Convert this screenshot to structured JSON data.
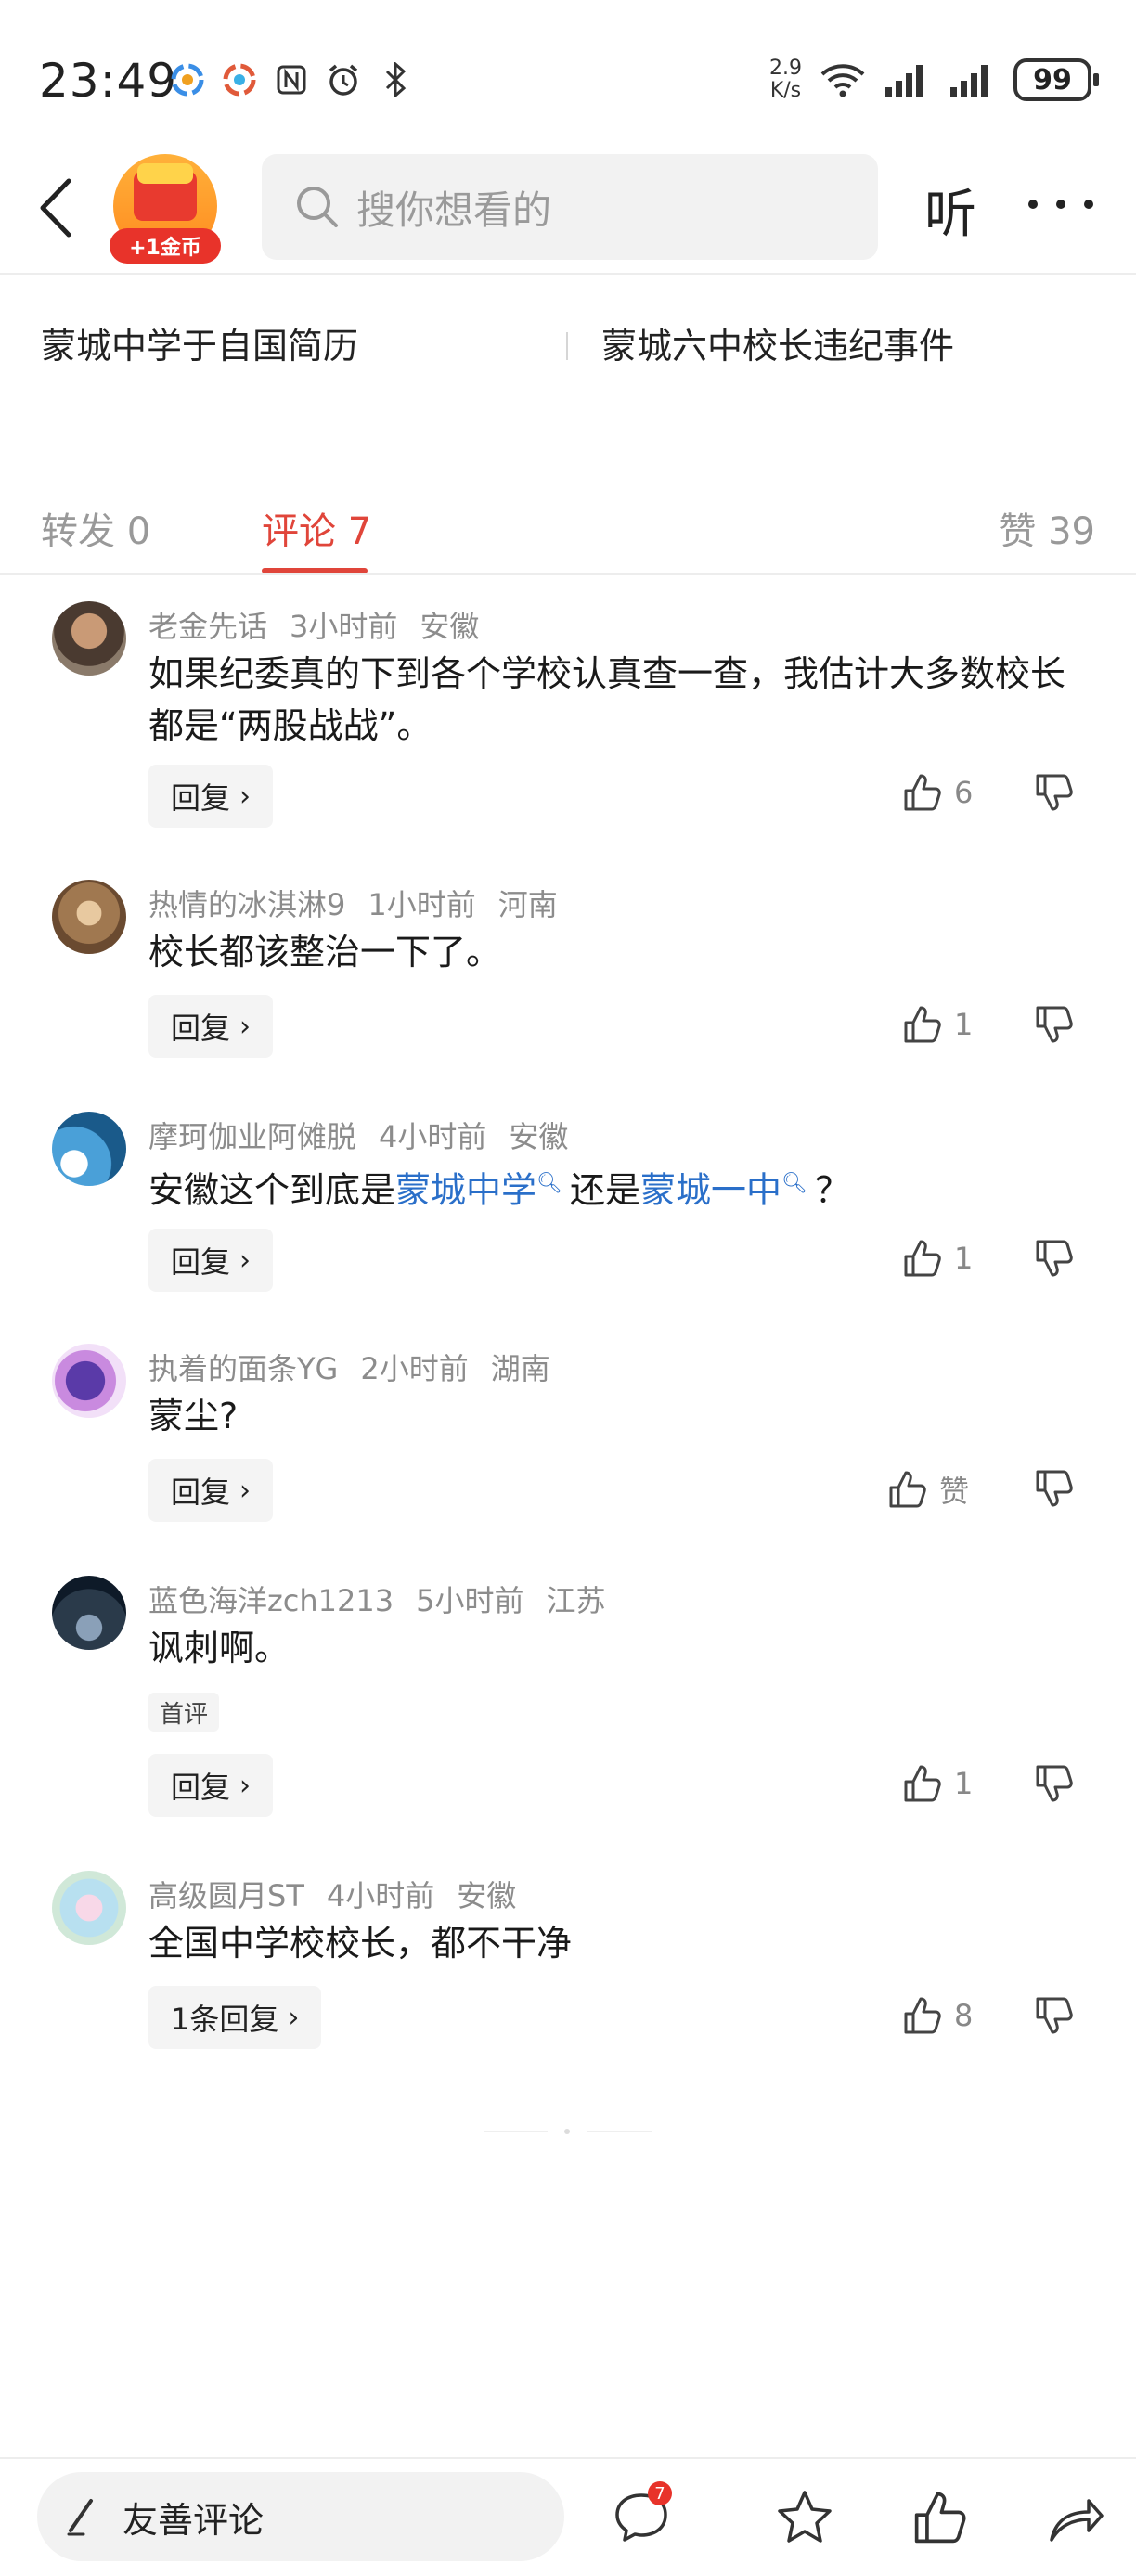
{
  "status_bar": {
    "time": "23:49",
    "net_speed_value": "2.9",
    "net_speed_unit": "K/s",
    "battery": "99"
  },
  "top_bar": {
    "coin_badge": "+1金币",
    "search_placeholder": "搜你想看的",
    "listen_label": "听"
  },
  "related_searches": [
    {
      "label": "蒙城中学于自国简历"
    },
    {
      "label": "蒙城六中校长违纪事件"
    }
  ],
  "tabs": [
    {
      "label": "转发 0"
    },
    {
      "label": "评论 7"
    },
    {
      "label": "赞 39"
    }
  ],
  "comments": [
    {
      "user": "老金先话",
      "time": "3小时前",
      "region": "安徽",
      "text": "如果纪委真的下到各个学校认真查一查，我估计大多数校长都是“两股战战”。",
      "reply_label": "回复",
      "likes": "6"
    },
    {
      "user": "热情的冰淇淋9",
      "time": "1小时前",
      "region": "河南",
      "text": "校长都该整治一下了。",
      "reply_label": "回复",
      "likes": "1"
    },
    {
      "user": "摩珂伽业阿傩脱",
      "time": "4小时前",
      "region": "安徽",
      "text_parts": [
        "安徽这个到底是",
        "蒙城中学",
        "还是",
        "蒙城一中",
        "？"
      ],
      "reply_label": "回复",
      "likes": "1"
    },
    {
      "user": "执着的面条YG",
      "time": "2小时前",
      "region": "湖南",
      "text": "蒙尘?",
      "reply_label": "回复",
      "likes": "赞"
    },
    {
      "user": "蓝色海洋zch1213",
      "time": "5小时前",
      "region": "江苏",
      "text": "讽刺啊。",
      "badge": "首评",
      "reply_label": "回复",
      "likes": "1"
    },
    {
      "user": "高级圆月ST",
      "time": "4小时前",
      "region": "安徽",
      "text": "全国中学校校长，都不干净",
      "reply_label": "1条回复",
      "likes": "8"
    }
  ],
  "bottom_bar": {
    "input_label": "友善评论",
    "comment_notif": "7"
  },
  "colors": {
    "accent": "#e0453a",
    "link": "#2a6fc9",
    "meta_gray": "#8c8c8c"
  }
}
